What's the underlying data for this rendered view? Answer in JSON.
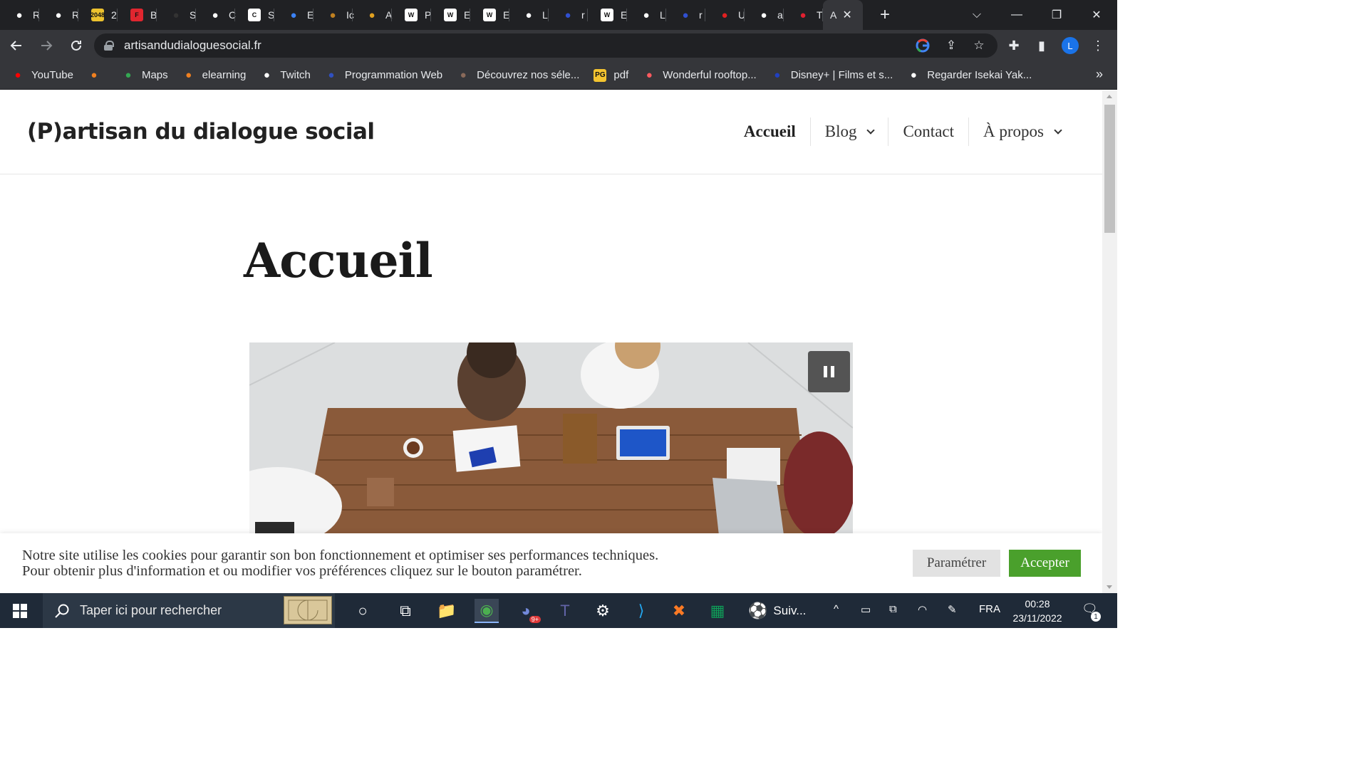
{
  "browser": {
    "tabs": [
      {
        "icon": "penguin-icon",
        "label": "R",
        "color": "#ffffff"
      },
      {
        "icon": "penguin-icon",
        "label": "R",
        "color": "#ffffff"
      },
      {
        "icon": "game-2048-icon",
        "label": "2",
        "badge": "2048",
        "color": "#edc22e"
      },
      {
        "icon": "f-logo-icon",
        "label": "B",
        "badge": "F",
        "color": "#e0262f"
      },
      {
        "icon": "ninja-icon",
        "label": "S",
        "color": "#333333"
      },
      {
        "icon": "ghost-icon",
        "label": "C",
        "color": "#ffffff"
      },
      {
        "icon": "c-logo-icon",
        "label": "S",
        "badge": "C",
        "color": "#ffffff"
      },
      {
        "icon": "d-logo-icon",
        "label": "E",
        "color": "#3b82f6"
      },
      {
        "icon": "anime-icon",
        "label": "Ic",
        "color": "#c08020"
      },
      {
        "icon": "figure-icon",
        "label": "A",
        "color": "#e0a020"
      },
      {
        "icon": "wordpress-icon",
        "label": "P",
        "badge": "W",
        "color": "#ffffff"
      },
      {
        "icon": "wordpress-icon",
        "label": "E",
        "badge": "W",
        "color": "#ffffff"
      },
      {
        "icon": "wordpress-icon",
        "label": "E",
        "badge": "W",
        "color": "#ffffff"
      },
      {
        "icon": "github-icon",
        "label": "L",
        "color": "#ffffff"
      },
      {
        "icon": "french-flag-icon",
        "label": "r",
        "color": "#3050d0"
      },
      {
        "icon": "wordpress-icon",
        "label": "E",
        "badge": "W",
        "color": "#ffffff"
      },
      {
        "icon": "github-icon",
        "label": "L",
        "color": "#ffffff"
      },
      {
        "icon": "french-flag-icon",
        "label": "r",
        "color": "#3050d0"
      },
      {
        "icon": "red-circle-icon",
        "label": "U",
        "color": "#e02020"
      },
      {
        "icon": "globe-icon",
        "label": "a",
        "color": "#ffffff"
      },
      {
        "icon": "heart-icon",
        "label": "T",
        "color": "#e02030"
      }
    ],
    "active_tab": {
      "label": "A",
      "close": "✕"
    },
    "new_tab": "+",
    "window_controls": {
      "chevron": "⌵",
      "minimize": "—",
      "restore": "❐",
      "close": "✕"
    },
    "url": "artisandudialoguesocial.fr",
    "bookmarks": [
      {
        "icon": "youtube-icon",
        "label": "YouTube",
        "color": "#ff0000"
      },
      {
        "icon": "mooc-icon",
        "label": "",
        "color": "#f08020"
      },
      {
        "icon": "maps-icon",
        "label": "Maps",
        "color": "#34a853"
      },
      {
        "icon": "mooc-icon",
        "label": "elearning",
        "color": "#f08020"
      },
      {
        "icon": "globe-icon",
        "label": "Twitch",
        "color": "#ffffff"
      },
      {
        "icon": "star-web-icon",
        "label": "Programmation Web",
        "color": "#3050c0"
      },
      {
        "icon": "grid-icon",
        "label": "Découvrez nos séle...",
        "color": "#8a6a5a"
      },
      {
        "icon": "pg-icon",
        "label": "pdf",
        "badge": "PG",
        "color": "#f4c430"
      },
      {
        "icon": "airbnb-icon",
        "label": "Wonderful rooftop...",
        "color": "#ff5a5f"
      },
      {
        "icon": "disney-icon",
        "label": "Disney+ | Films et s...",
        "color": "#2040c0"
      },
      {
        "icon": "penguin-icon",
        "label": "Regarder Isekai Yak...",
        "color": "#ffffff"
      }
    ],
    "bookmarks_more": "»"
  },
  "site": {
    "title": "(P)artisan du dialogue social",
    "nav": [
      {
        "label": "Accueil",
        "dropdown": false
      },
      {
        "label": "Blog",
        "dropdown": true
      },
      {
        "label": "Contact",
        "dropdown": false
      },
      {
        "label": "À propos",
        "dropdown": true
      }
    ],
    "page_title": "Accueil",
    "hero_alt": "meeting-around-wooden-table-photo",
    "cookie": {
      "line1": "Notre site utilise les cookies pour garantir son bon fonctionnement et optimiser ses performances techniques.",
      "line2": "Pour obtenir plus d'information et ou modifier vos préférences cliquez sur le bouton paramétrer.",
      "settings_label": "Paramétrer",
      "accept_label": "Accepter",
      "accept_color": "#4aa02c"
    }
  },
  "taskbar": {
    "search_placeholder": "Taper ici pour rechercher",
    "apps": [
      {
        "icon": "cortana-icon"
      },
      {
        "icon": "task-view-icon"
      },
      {
        "icon": "file-explorer-icon"
      },
      {
        "icon": "chrome-icon"
      },
      {
        "icon": "discord-icon",
        "badge": "9+"
      },
      {
        "icon": "teams-icon"
      },
      {
        "icon": "settings-icon"
      },
      {
        "icon": "vscode-icon"
      },
      {
        "icon": "xampp-icon"
      },
      {
        "icon": "sheets-icon"
      },
      {
        "icon": "game-icon",
        "label": "Suiv..."
      }
    ],
    "language": "FRA",
    "time": "00:28",
    "date": "23/11/2022",
    "notifications": "1"
  }
}
